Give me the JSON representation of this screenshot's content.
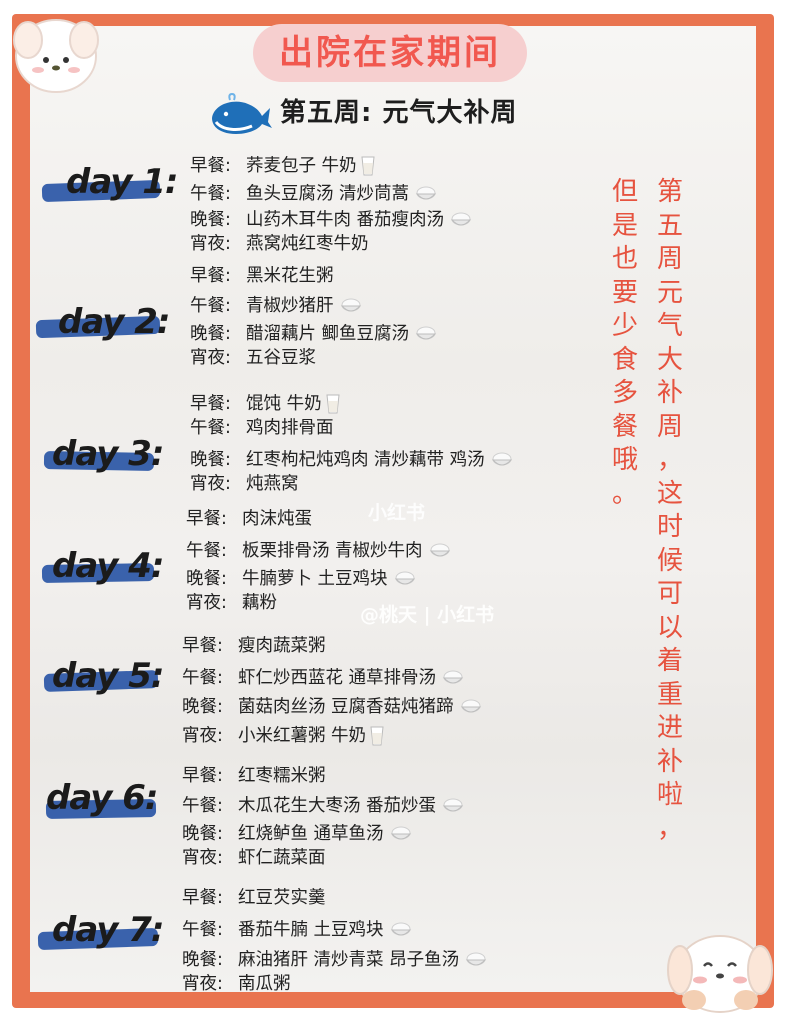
{
  "title": "出院在家期间",
  "week_title": "第五周:  元气大补周",
  "days": [
    {
      "label": "day 1:",
      "meals": [
        {
          "key": "早餐:",
          "text": "荞麦包子 牛奶",
          "icon": "milk-cup"
        },
        {
          "key": "午餐:",
          "text": "鱼头豆腐汤 清炒茼蒿",
          "icon": "rice-bowl"
        },
        {
          "key": "晚餐:",
          "text": "山药木耳牛肉 番茄瘦肉汤",
          "icon": "rice-bowl"
        },
        {
          "key": "宵夜:",
          "text": "燕窝炖红枣牛奶",
          "icon": ""
        }
      ]
    },
    {
      "label": "day 2:",
      "meals": [
        {
          "key": "早餐:",
          "text": "黑米花生粥",
          "icon": ""
        },
        {
          "key": "午餐:",
          "text": "青椒炒猪肝",
          "icon": "rice-bowl"
        },
        {
          "key": "晚餐:",
          "text": "醋溜藕片 鲫鱼豆腐汤",
          "icon": "rice-bowl"
        },
        {
          "key": "宵夜:",
          "text": "五谷豆浆",
          "icon": ""
        }
      ]
    },
    {
      "label": "day 3:",
      "meals": [
        {
          "key": "早餐:",
          "text": "馄饨 牛奶",
          "icon": "milk-cup"
        },
        {
          "key": "午餐:",
          "text": "鸡肉排骨面",
          "icon": ""
        },
        {
          "key": "晚餐:",
          "text": "红枣枸杞炖鸡肉 清炒藕带 鸡汤",
          "icon": "rice-bowl"
        },
        {
          "key": "宵夜:",
          "text": "炖燕窝",
          "icon": ""
        }
      ]
    },
    {
      "label": "day 4:",
      "meals": [
        {
          "key": "早餐:",
          "text": "肉沫炖蛋",
          "icon": ""
        },
        {
          "key": "午餐:",
          "text": "板栗排骨汤 青椒炒牛肉",
          "icon": "rice-bowl"
        },
        {
          "key": "晚餐:",
          "text": "牛腩萝卜 土豆鸡块",
          "icon": "rice-bowl"
        },
        {
          "key": "宵夜:",
          "text": "藕粉",
          "icon": ""
        }
      ]
    },
    {
      "label": "day 5:",
      "meals": [
        {
          "key": "早餐:",
          "text": "瘦肉蔬菜粥",
          "icon": ""
        },
        {
          "key": "午餐:",
          "text": "虾仁炒西蓝花 通草排骨汤",
          "icon": "rice-bowl"
        },
        {
          "key": "晚餐:",
          "text": "菌菇肉丝汤 豆腐香菇炖猪蹄",
          "icon": "rice-bowl"
        },
        {
          "key": "宵夜:",
          "text": "小米红薯粥 牛奶",
          "icon": "milk-cup"
        }
      ]
    },
    {
      "label": "day 6:",
      "meals": [
        {
          "key": "早餐:",
          "text": "红枣糯米粥",
          "icon": ""
        },
        {
          "key": "午餐:",
          "text": "木瓜花生大枣汤 番茄炒蛋",
          "icon": "rice-bowl"
        },
        {
          "key": "晚餐:",
          "text": "红烧鲈鱼 通草鱼汤",
          "icon": "rice-bowl"
        },
        {
          "key": "宵夜:",
          "text": "虾仁蔬菜面",
          "icon": ""
        }
      ]
    },
    {
      "label": "day 7:",
      "meals": [
        {
          "key": "早餐:",
          "text": "红豆芡实羹",
          "icon": ""
        },
        {
          "key": "午餐:",
          "text": "番茄牛腩 土豆鸡块",
          "icon": "rice-bowl"
        },
        {
          "key": "晚餐:",
          "text": "麻油猪肝 清炒青菜 昂子鱼汤",
          "icon": "rice-bowl"
        },
        {
          "key": "宵夜:",
          "text": "南瓜粥",
          "icon": ""
        }
      ]
    }
  ],
  "side_note_col1": "第五周元气大补周，这时候可以着重进补啦，",
  "side_note_col2": "但是也要少食多餐哦。",
  "watermark_top": "小红书",
  "watermark_mid": "@桃天 | 小红书",
  "colors": {
    "border": "#e9744f",
    "title_pill": "#f6cfcf",
    "title_text": "#f1584f",
    "side_text": "#e6533f",
    "day_stroke": "#2f5aa8"
  }
}
